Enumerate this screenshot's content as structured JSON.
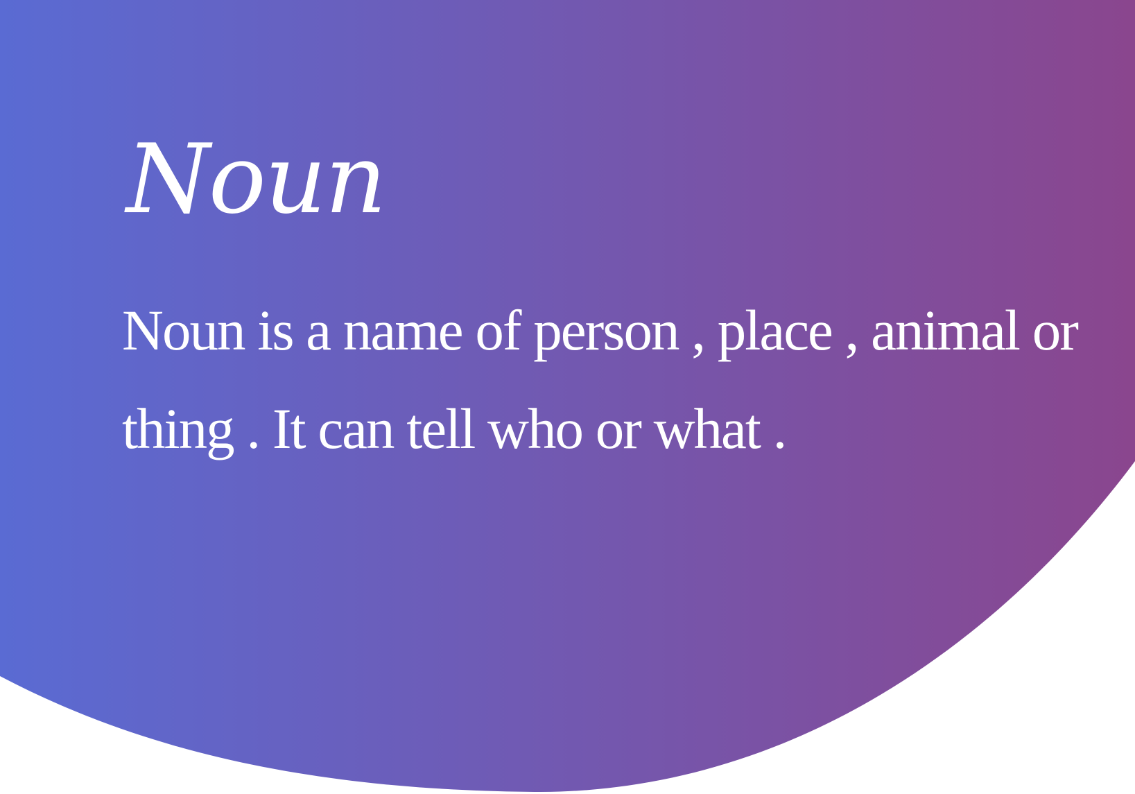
{
  "slide": {
    "title": "Noun",
    "definition": "Noun is a name of person , place , animal or thing . It can tell who or what ."
  },
  "colors": {
    "gradient_start": "#5a6bd3",
    "gradient_end": "#8a468e",
    "text": "#ffffff",
    "background": "#ffffff"
  }
}
